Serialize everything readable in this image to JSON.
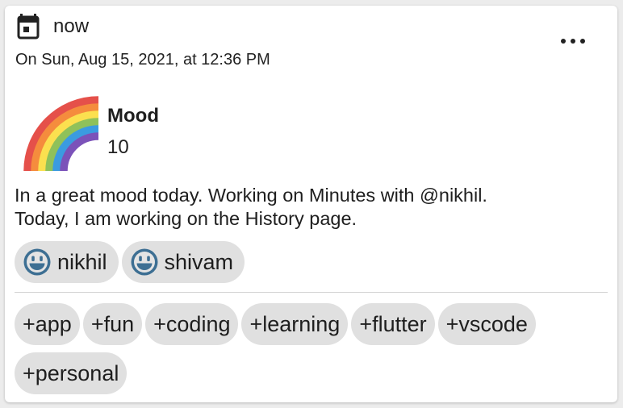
{
  "header": {
    "relative_time": "now",
    "datetime": "On Sun, Aug 15, 2021, at 12:36 PM",
    "menu_icon": "more-horizontal-icon",
    "calendar_icon": "calendar-icon"
  },
  "mood": {
    "label": "Mood",
    "value": "10",
    "icon": "rainbow"
  },
  "note": {
    "line1": "In a great mood today. Working on Minutes with @nikhil.",
    "line2": "Today, I am working on the History page."
  },
  "people": [
    {
      "name": "nikhil"
    },
    {
      "name": "shivam"
    }
  ],
  "tags": [
    "+app",
    "+fun",
    "+coding",
    "+learning",
    "+flutter",
    "+vscode",
    "+personal"
  ],
  "colors": {
    "chip_bg": "#e0e0e0",
    "smiley_blue": "#3d6f93"
  }
}
